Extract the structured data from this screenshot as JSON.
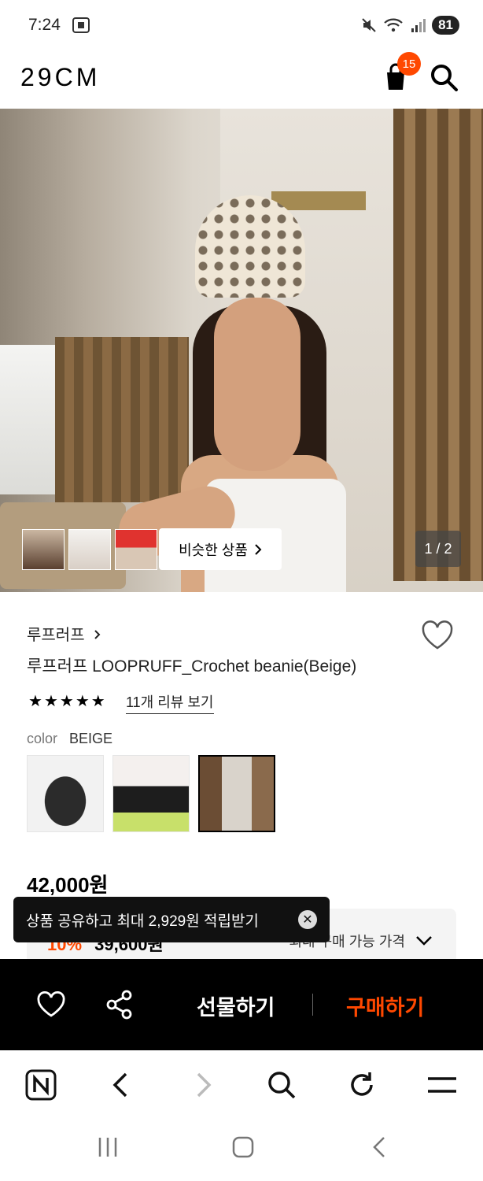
{
  "status_bar": {
    "time": "7:24",
    "battery": "81"
  },
  "header": {
    "logo": "29CM",
    "cart_count": "15"
  },
  "gallery": {
    "similar_label": "비슷한 상품",
    "page_indicator": "1 / 2"
  },
  "product": {
    "brand": "루프러프",
    "title": "루프러프 LOOPRUFF_Crochet beanie(Beige)",
    "rating_stars": 5,
    "review_link": "11개 리뷰 보기",
    "color_label": "color",
    "color_value": "BEIGE",
    "price": "42,000원",
    "discount_rate": "10%",
    "discount_price_partial": "39,600원",
    "discount_right_label": "최대 구매 가능 가격"
  },
  "toast": {
    "text": "상품 공유하고 최대 2,929원 적립받기"
  },
  "action_bar": {
    "gift_label": "선물하기",
    "buy_label": "구매하기"
  },
  "colors": {
    "accent": "#ff4800",
    "bar_bg": "#000000"
  }
}
